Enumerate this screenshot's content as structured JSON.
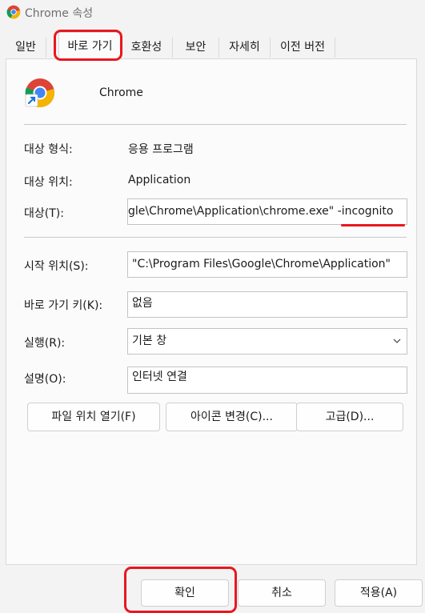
{
  "window": {
    "title": "Chrome 속성"
  },
  "tabs": [
    {
      "label": "일반"
    },
    {
      "label": "바로 가기"
    },
    {
      "label": "호환성"
    },
    {
      "label": "보안"
    },
    {
      "label": "자세히"
    },
    {
      "label": "이전 버전"
    }
  ],
  "active_tab": "바로 가기",
  "shortcut": {
    "name": "Chrome",
    "target_type_label": "대상 형식:",
    "target_type_value": "응용 프로그램",
    "target_location_label": "대상 위치:",
    "target_location_value": "Application",
    "target_label": "대상(T):",
    "target_value": "gle\\Chrome\\Application\\chrome.exe\" -incognito",
    "start_in_label": "시작 위치(S):",
    "start_in_value": "\"C:\\Program Files\\Google\\Chrome\\Application\"",
    "shortcut_key_label": "바로 가기 키(K):",
    "shortcut_key_value": "없음",
    "run_label": "실행(R):",
    "run_value": "기본 창",
    "comment_label": "설명(O):",
    "comment_value": "인터넷 연결"
  },
  "buttons": {
    "open_location": "파일 위치 열기(F)",
    "change_icon": "아이콘 변경(C)...",
    "advanced": "고급(D)..."
  },
  "footer": {
    "ok": "확인",
    "cancel": "취소",
    "apply": "적용(A)"
  },
  "colors": {
    "annotation": "#e8171f",
    "panel": "#fbfbfb",
    "window": "#f3f3f3"
  }
}
